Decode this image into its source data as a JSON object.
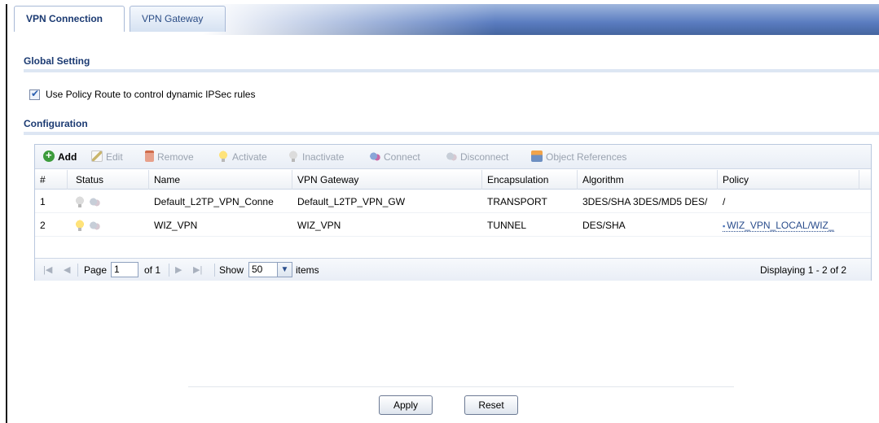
{
  "tabs": [
    {
      "label": "VPN Connection",
      "active": true
    },
    {
      "label": "VPN Gateway",
      "active": false
    }
  ],
  "global_setting": {
    "title": "Global Setting",
    "policy_route_checkbox": {
      "label": "Use Policy Route to control dynamic IPSec rules",
      "checked": true
    }
  },
  "configuration": {
    "title": "Configuration",
    "toolbar": {
      "add": "Add",
      "edit": "Edit",
      "remove": "Remove",
      "activate": "Activate",
      "inactivate": "Inactivate",
      "connect": "Connect",
      "disconnect": "Disconnect",
      "object_references": "Object References"
    },
    "columns": [
      "#",
      "Status",
      "Name",
      "VPN Gateway",
      "Encapsulation",
      "Algorithm",
      "Policy"
    ],
    "rows": [
      {
        "num": "1",
        "name": "Default_L2TP_VPN_Conne",
        "gateway": "Default_L2TP_VPN_GW",
        "encapsulation": "TRANSPORT",
        "algorithm": "3DES/SHA 3DES/MD5 DES/",
        "policy": "/",
        "active": false
      },
      {
        "num": "2",
        "name": "WIZ_VPN",
        "gateway": "WIZ_VPN",
        "encapsulation": "TUNNEL",
        "algorithm": "DES/SHA",
        "policy": "WIZ_VPN_LOCAL/WIZ_",
        "active": true
      }
    ],
    "pager": {
      "page_label": "Page",
      "page_value": "1",
      "of_label": "of 1",
      "show_label": "Show",
      "show_value": "50",
      "items_label": "items",
      "displaying": "Displaying 1 - 2 of 2"
    }
  },
  "buttons": {
    "apply": "Apply",
    "reset": "Reset"
  },
  "colors": {
    "accent": "#1b3a72",
    "header_blue": "#5a7cc0"
  }
}
